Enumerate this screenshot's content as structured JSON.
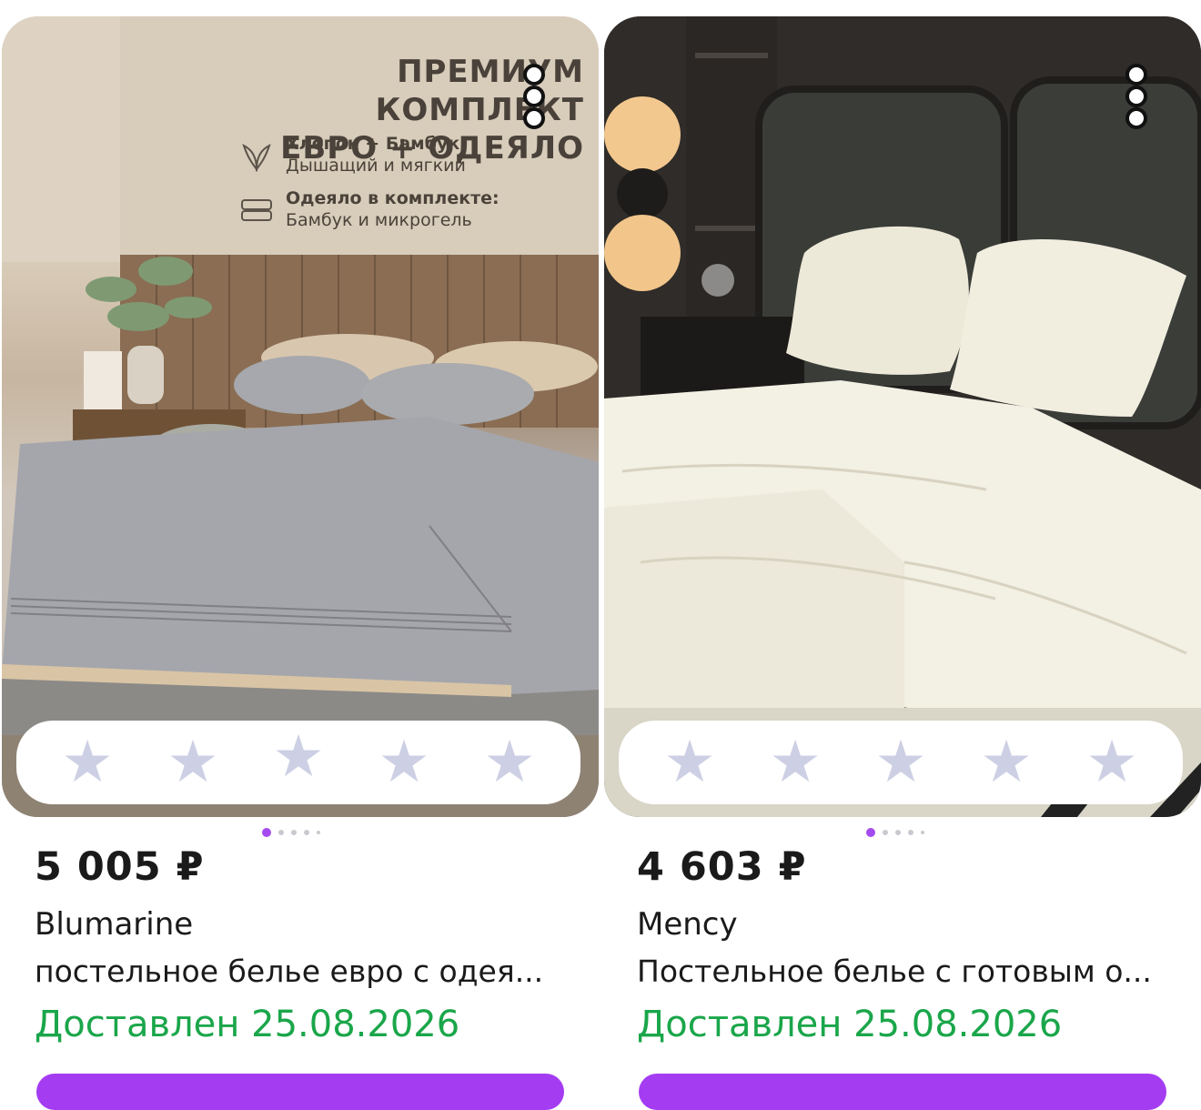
{
  "products": [
    {
      "promo": {
        "title_line1": "ПРЕМИУМ КОМПЛЕКТ",
        "title_line2": "ЕВРО + ОДЕЯЛО",
        "feature1_title": "Хлопок + Бамбук:",
        "feature1_text": "Дышащий и мягкий",
        "feature2_title": "Одеяло в комплекте:",
        "feature2_text": "Бамбук и микрогель"
      },
      "rating_stars": [
        "★",
        "★",
        "★",
        "★",
        "★"
      ],
      "price": "5 005 ₽",
      "brand": "Blumarine",
      "description": "постельное белье евро с одея...",
      "delivery": "Доставлен 25.08.2026"
    },
    {
      "rating_stars": [
        "★",
        "★",
        "★",
        "★",
        "★"
      ],
      "price": "4 603 ₽",
      "brand": "Mency",
      "description": "Постельное белье с готовым о...",
      "delivery": "Доставлен 25.08.2026"
    }
  ],
  "colors": {
    "price_text": "#1a1a1a",
    "delivery_green": "#1aa64a",
    "accent_purple": "#a44bf0",
    "star_inactive": "#cdd0e4"
  }
}
